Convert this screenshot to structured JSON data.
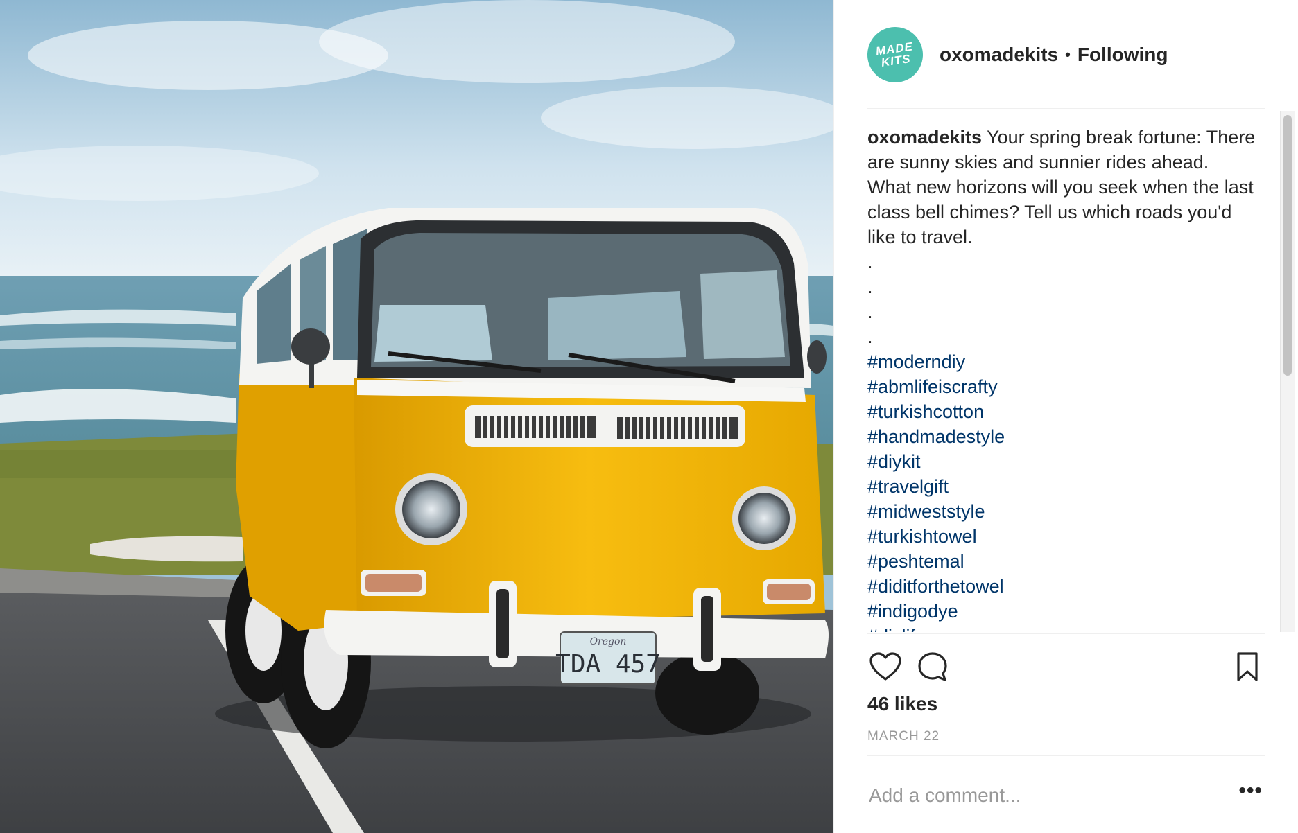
{
  "post": {
    "photo_description_icon": "van-photo",
    "plate_text": "TDA 457",
    "plate_state": "Oregon"
  },
  "header": {
    "avatar_line1": "MADE",
    "avatar_line2": "KITS",
    "username": "oxomadekits",
    "separator": "•",
    "follow_status": "Following"
  },
  "caption": {
    "username": "oxomadekits",
    "text": "Your spring break fortune: There are sunny skies and sunnier rides ahead. What new horizons will you seek when the last class bell chimes? Tell us which roads you'd like to travel.",
    "dots": [
      ".",
      ".",
      ".",
      "."
    ],
    "hashtags": [
      "#moderndiy",
      "#abmlifeiscrafty",
      "#turkishcotton",
      "#handmadestyle",
      "#diykit",
      "#travelgift",
      "#midweststyle",
      "#turkishtowel",
      "#peshtemal",
      "#diditforthetowel",
      "#indigodye",
      "#diylife"
    ]
  },
  "actions": {
    "like_icon": "heart-icon",
    "comment_icon": "comment-icon",
    "save_icon": "bookmark-icon"
  },
  "likes": "46 likes",
  "date": "MARCH 22",
  "comment_box": {
    "placeholder": "Add a comment...",
    "more_label": "•••"
  },
  "colors": {
    "hashtag": "#003569",
    "avatar_bg": "#4cbfae",
    "van_yellow": "#f2b705"
  }
}
